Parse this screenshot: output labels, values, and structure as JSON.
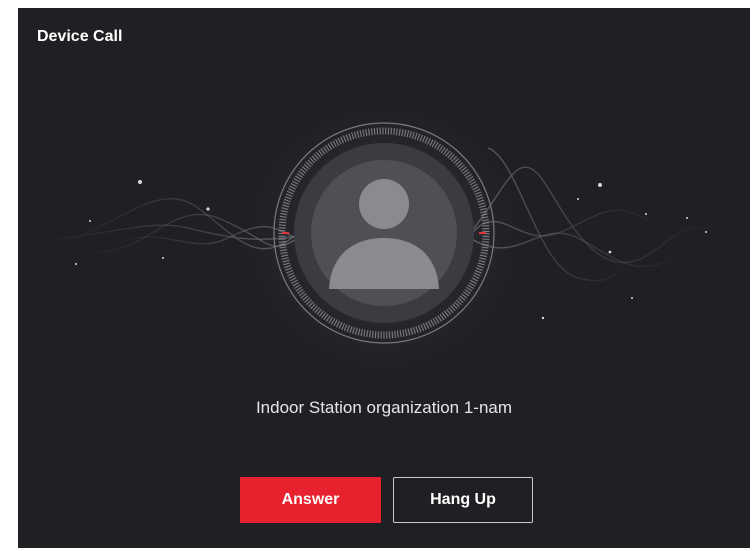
{
  "dialog": {
    "title": "Device Call",
    "caller_name": "Indoor Station organization 1-nam",
    "answer_label": "Answer",
    "hangup_label": "Hang Up"
  },
  "colors": {
    "background": "#1f2023",
    "answer_button": "#e8212e",
    "avatar": "#8a8a90",
    "ring_accent": "#e0323c"
  },
  "icons": {
    "avatar": "person-avatar-icon"
  }
}
